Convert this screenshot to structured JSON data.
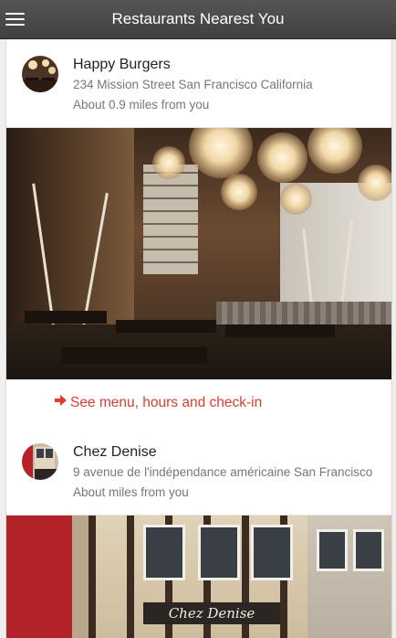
{
  "header": {
    "title": "Restaurants Nearest You",
    "menu_icon": "hamburger-menu-icon"
  },
  "restaurants": [
    {
      "name": "Happy Burgers",
      "address": "234 Mission Street San Francisco California",
      "distance": "About 0.9 miles from you",
      "cta": "See menu, hours and check-in",
      "cta_icon": "arrow-right-icon"
    },
    {
      "name": "Chez Denise",
      "address": "9 avenue de l'indépendance américaine San Francisco",
      "distance": "About miles from you",
      "storefront_sign": "Chez Denise"
    }
  ],
  "colors": {
    "header_bg": "#474747",
    "accent": "#e03b2f",
    "secondary_text": "#777777"
  }
}
